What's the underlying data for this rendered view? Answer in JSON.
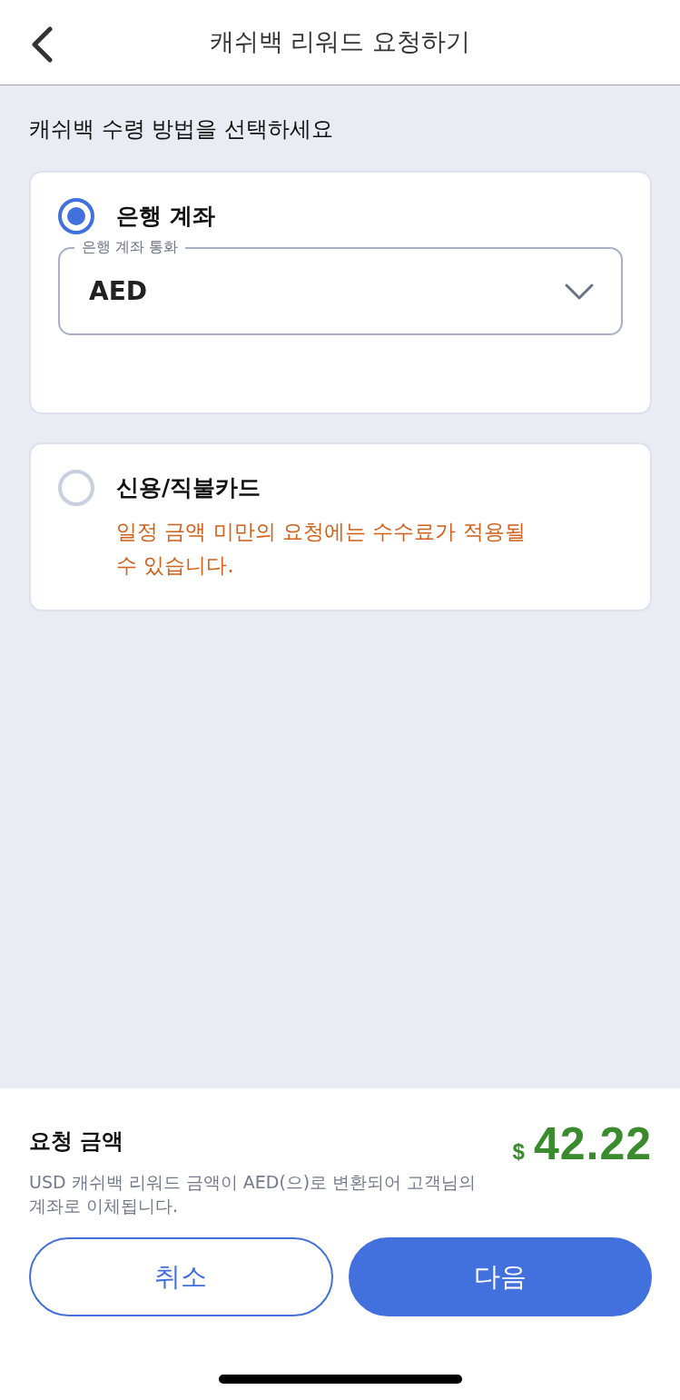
{
  "header": {
    "title": "캐쉬백 리워드 요청하기"
  },
  "prompt": "캐쉬백 수령 방법을 선택하세요",
  "options": [
    {
      "label": "은행 계좌",
      "selected": true,
      "field": {
        "label": "은행 계좌 통화",
        "value": "AED"
      }
    },
    {
      "label": "신용/직불카드",
      "selected": false,
      "note": "일정 금액 미만의 요청에는 수수료가 적용될 수 있습니다."
    }
  ],
  "summary": {
    "label": "요청 금액",
    "currency": "$",
    "amount": "42.22",
    "description": "USD 캐쉬백 리워드 금액이 AED(으)로 변환되어 고객님의 계좌로 이체됩니다."
  },
  "buttons": [
    {
      "kind": "secondary",
      "label": "취소"
    },
    {
      "kind": "primary",
      "label": "다음"
    }
  ]
}
